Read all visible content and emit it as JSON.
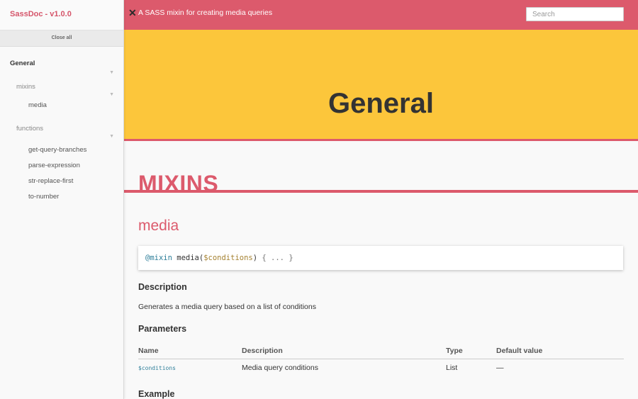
{
  "sidebar": {
    "title": "SassDoc - v1.0.0",
    "close_all": "Close all",
    "group": "General",
    "caret": "▼",
    "mixins_label": "mixins",
    "mixins_items": [
      "media"
    ],
    "functions_label": "functions",
    "functions_items": [
      "get-query-branches",
      "parse-expression",
      "str-replace-first",
      "to-number"
    ]
  },
  "header": {
    "close_glyph": "✕",
    "description": "A SASS mixin for creating media queries",
    "search_placeholder": "Search"
  },
  "banner": {
    "title": "General"
  },
  "main": {
    "section_title": "MIXINS",
    "item_title": "media",
    "code": {
      "keyword": "@mixin",
      "name": " media(",
      "param": "$conditions",
      "close": ")",
      "body": " { ... }"
    },
    "description_heading": "Description",
    "description_text": "Generates a media query based on a list of conditions",
    "parameters_heading": "Parameters",
    "table": {
      "headers": [
        "Name",
        "Description",
        "Type",
        "Default value"
      ],
      "rows": [
        [
          "$conditions",
          "Media query conditions",
          "List",
          "—"
        ]
      ]
    },
    "example_heading": "Example"
  },
  "colors": {
    "accent": "#dc5a6c",
    "banner": "#fcc63b"
  }
}
